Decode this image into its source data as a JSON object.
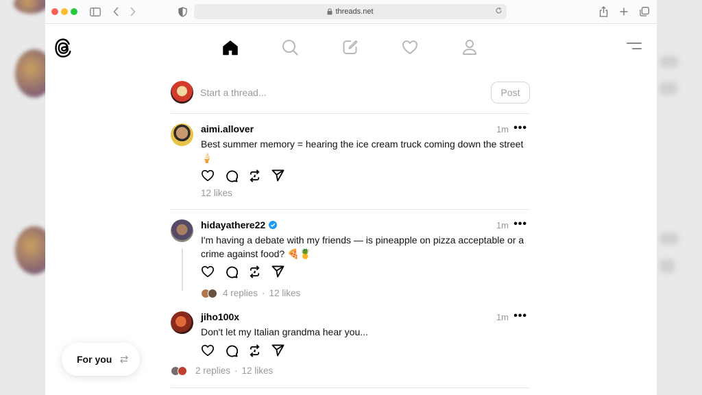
{
  "browser": {
    "url": "threads.net"
  },
  "composer": {
    "placeholder": "Start a thread...",
    "post_label": "Post"
  },
  "posts": [
    {
      "username": "aimi.allover",
      "verified": false,
      "time": "1m",
      "text": "Best summer memory = hearing the ice cream truck coming down the street 🍦",
      "likes": "12 likes"
    },
    {
      "username": "hidayathere22",
      "verified": true,
      "time": "1m",
      "text": "I'm having a debate with my friends — is pineapple on pizza acceptable or a crime against food? 🍕🍍",
      "replies": "4 replies",
      "likes": "12 likes"
    },
    {
      "username": "jiho100x",
      "verified": false,
      "time": "1m",
      "text": "Don't let my Italian grandma hear you...",
      "replies": "2 replies",
      "likes": "12 likes"
    }
  ],
  "feed_switcher": {
    "label": "For you"
  },
  "colors": {
    "verified": "#1d9bf0",
    "muted_text": "#999999",
    "divider": "#e6e6e6"
  }
}
